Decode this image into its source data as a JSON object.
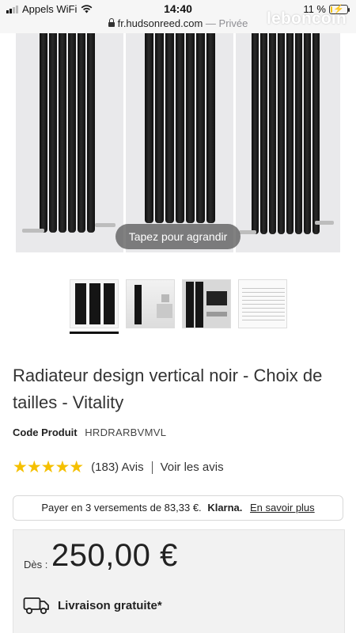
{
  "status_bar": {
    "carrier": "Appels WiFi",
    "time": "14:40",
    "battery": "11 %",
    "battery_level": 0.11
  },
  "browser": {
    "url": "fr.hudsonreed.com",
    "separator": "—",
    "mode": "Privée"
  },
  "watermark": "leboncoin",
  "gallery": {
    "hint": "Tapez pour agrandir",
    "thumbnails": [
      "thumb-1",
      "thumb-2",
      "thumb-3",
      "thumb-4"
    ],
    "active_index": 0
  },
  "product": {
    "title": "Radiateur design vertical noir - Choix de tailles - Vitality",
    "code_label": "Code Produit",
    "code_value": "HRDRARBVMVL",
    "stars": "★★★★★",
    "rating_count": "(183) Avis",
    "see_reviews": "Voir les avis"
  },
  "klarna": {
    "text": "Payer en 3 versements de 83,33 €.",
    "brand": "Klarna.",
    "link": "En savoir plus"
  },
  "price": {
    "from_label": "Dès :",
    "value": "250,00 €"
  },
  "delivery": {
    "label": "Livraison gratuite*",
    "icon": "truck-icon"
  },
  "colors": {
    "stars": "#f5c000",
    "radiator": "#151515",
    "price_box": "#f2f2f2"
  }
}
